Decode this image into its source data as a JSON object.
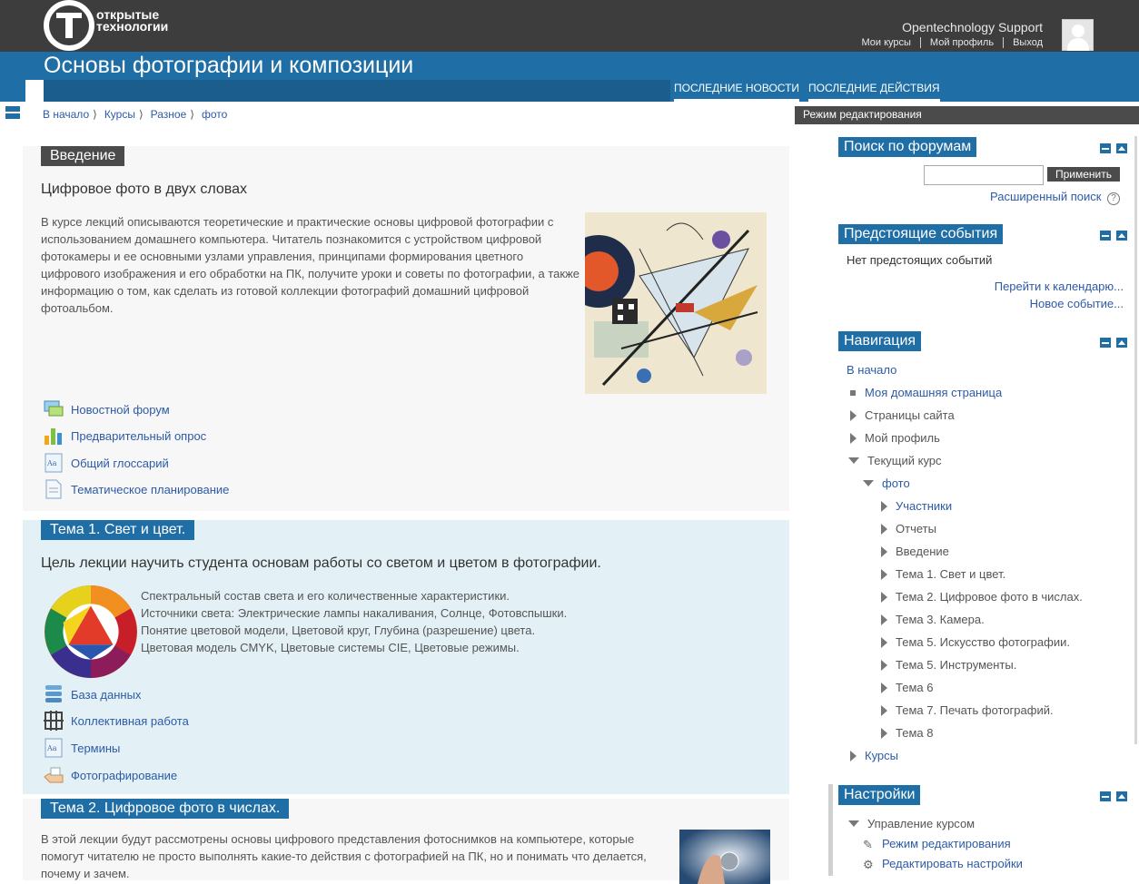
{
  "header": {
    "logo_line1": "открытые",
    "logo_line2": "технологии",
    "user_name": "Opentechnology Support",
    "user_links": [
      "Мои курсы",
      "Мой профиль",
      "Выход"
    ],
    "course_title": "Основы фотографии и композиции",
    "nav_buttons": [
      "ПОСЛЕДНИЕ НОВОСТИ",
      "ПОСЛЕДНИЕ ДЕЙСТВИЯ"
    ]
  },
  "breadcrumb": [
    "В начало",
    "Курсы",
    "Разное",
    "фото"
  ],
  "sections": {
    "intro": {
      "title": "Введение",
      "subtitle": "Цифровое фото в двух словах",
      "text": "В курсе лекций описываются теоретические и практические основы цифровой фотографии с использованием домашнего компьютера. Читатель познакомится с устройством цифровой фотокамеры и ее основными узлами управления, принципами формирования цветного цифрового изображения и его обработки на ПК, получите уроки и советы по фотографии, а также информацию о том, как сделать из готовой коллекции фотографий домашний цифровой фотоальбом.",
      "activities": [
        "Новостной форум",
        "Предварительный опрос",
        "Общий глоссарий",
        "Тематическое планирование"
      ]
    },
    "topic1": {
      "title": "Тема 1. Свет и цвет.",
      "subtitle": "Цель лекции научить студента основам работы со светом и цветом в фотографии.",
      "lines": [
        "Спектральный состав света и его количественные характеристики.",
        "Источники света: Электрические лампы накаливания, Солнце, Фотовспышки.",
        "Понятие цветовой модели, Цветовой круг, Глубина (разрешение) цвета.",
        "Цветовая модель CMYK, Цветовые системы CIE, Цветовые режимы."
      ],
      "activities": [
        "База данных",
        "Коллективная работа",
        "Термины",
        "Фотографирование"
      ]
    },
    "topic2": {
      "title": "Тема 2. Цифровое фото в числах.",
      "text": "В этой лекции будут рассмотрены основы цифрового представления фотоснимков на компьютере, которые помогут читателю не просто выполнять какие-то действия с фотографией на ПК, но и понимать что делается, почему и зачем."
    }
  },
  "sidebar": {
    "edit_mode": "Режим редактирования",
    "search": {
      "title": "Поиск по форумам",
      "button": "Применить",
      "advanced": "Расширенный поиск"
    },
    "events": {
      "title": "Предстоящие события",
      "empty": "Нет предстоящих событий",
      "calendar": "Перейти к календарю...",
      "new_event": "Новое событие..."
    },
    "navigation": {
      "title": "Навигация",
      "home": "В начало",
      "my_home": "Моя домашняя страница",
      "site_pages": "Страницы сайта",
      "my_profile": "Мой профиль",
      "current_course": "Текущий курс",
      "course": "фото",
      "children": [
        "Участники",
        "Отчеты",
        "Введение",
        "Тема 1. Свет и цвет.",
        "Тема 2. Цифровое фото в числах.",
        "Тема 3. Камера.",
        "Тема 5. Искусство фотографии.",
        "Тема 5. Инструменты.",
        "Тема 6",
        "Тема 7. Печать фотографий.",
        "Тема 8"
      ],
      "courses": "Курсы"
    },
    "settings": {
      "title": "Настройки",
      "course_admin": "Управление курсом",
      "edit_mode": "Режим редактирования",
      "edit_settings": "Редактировать настройки"
    }
  },
  "colors": {
    "accent": "#1f6fa6",
    "dark": "#3d3d3d",
    "link": "#2d5aa6"
  }
}
